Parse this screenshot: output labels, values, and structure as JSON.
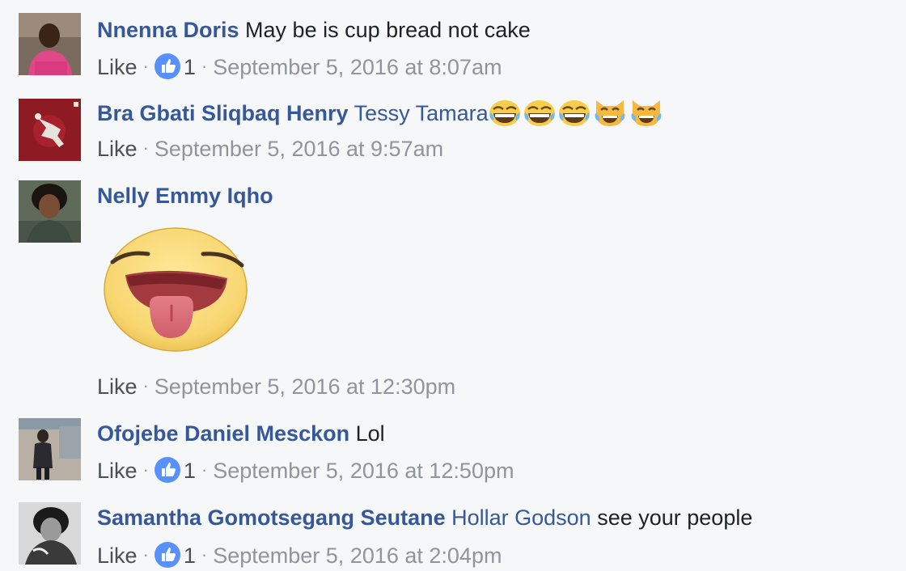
{
  "comments": [
    {
      "author": "Nnenna Doris",
      "text": "May be is cup bread not cake",
      "like_label": "Like",
      "reaction_count": "1",
      "timestamp": "September 5, 2016 at 8:07am"
    },
    {
      "author": "Bra Gbati Sliqbaq Henry",
      "mention": "Tessy Tamara",
      "emojis": [
        "grinning-sweat",
        "grinning-sweat",
        "grinning-sweat",
        "cat-tears-of-joy",
        "cat-tears-of-joy"
      ],
      "like_label": "Like",
      "timestamp": "September 5, 2016 at 9:57am"
    },
    {
      "author": "Nelly Emmy Iqho",
      "sticker": "tongue-out-face",
      "like_label": "Like",
      "timestamp": "September 5, 2016 at 12:30pm"
    },
    {
      "author": "Ofojebe Daniel Mesckon",
      "text": "Lol",
      "like_label": "Like",
      "reaction_count": "1",
      "timestamp": "September 5, 2016 at 12:50pm"
    },
    {
      "author": "Samantha Gomotsegang Seutane",
      "mention": "Hollar Godson",
      "text": "see your people",
      "like_label": "Like",
      "reaction_count": "1",
      "timestamp": "September 5, 2016 at 2:04pm"
    }
  ],
  "colors": {
    "background": "#f6f7f9",
    "author_link": "#365899",
    "body_text": "#1d2129",
    "meta_text": "#90949c",
    "like_blue": "#5890ff"
  }
}
